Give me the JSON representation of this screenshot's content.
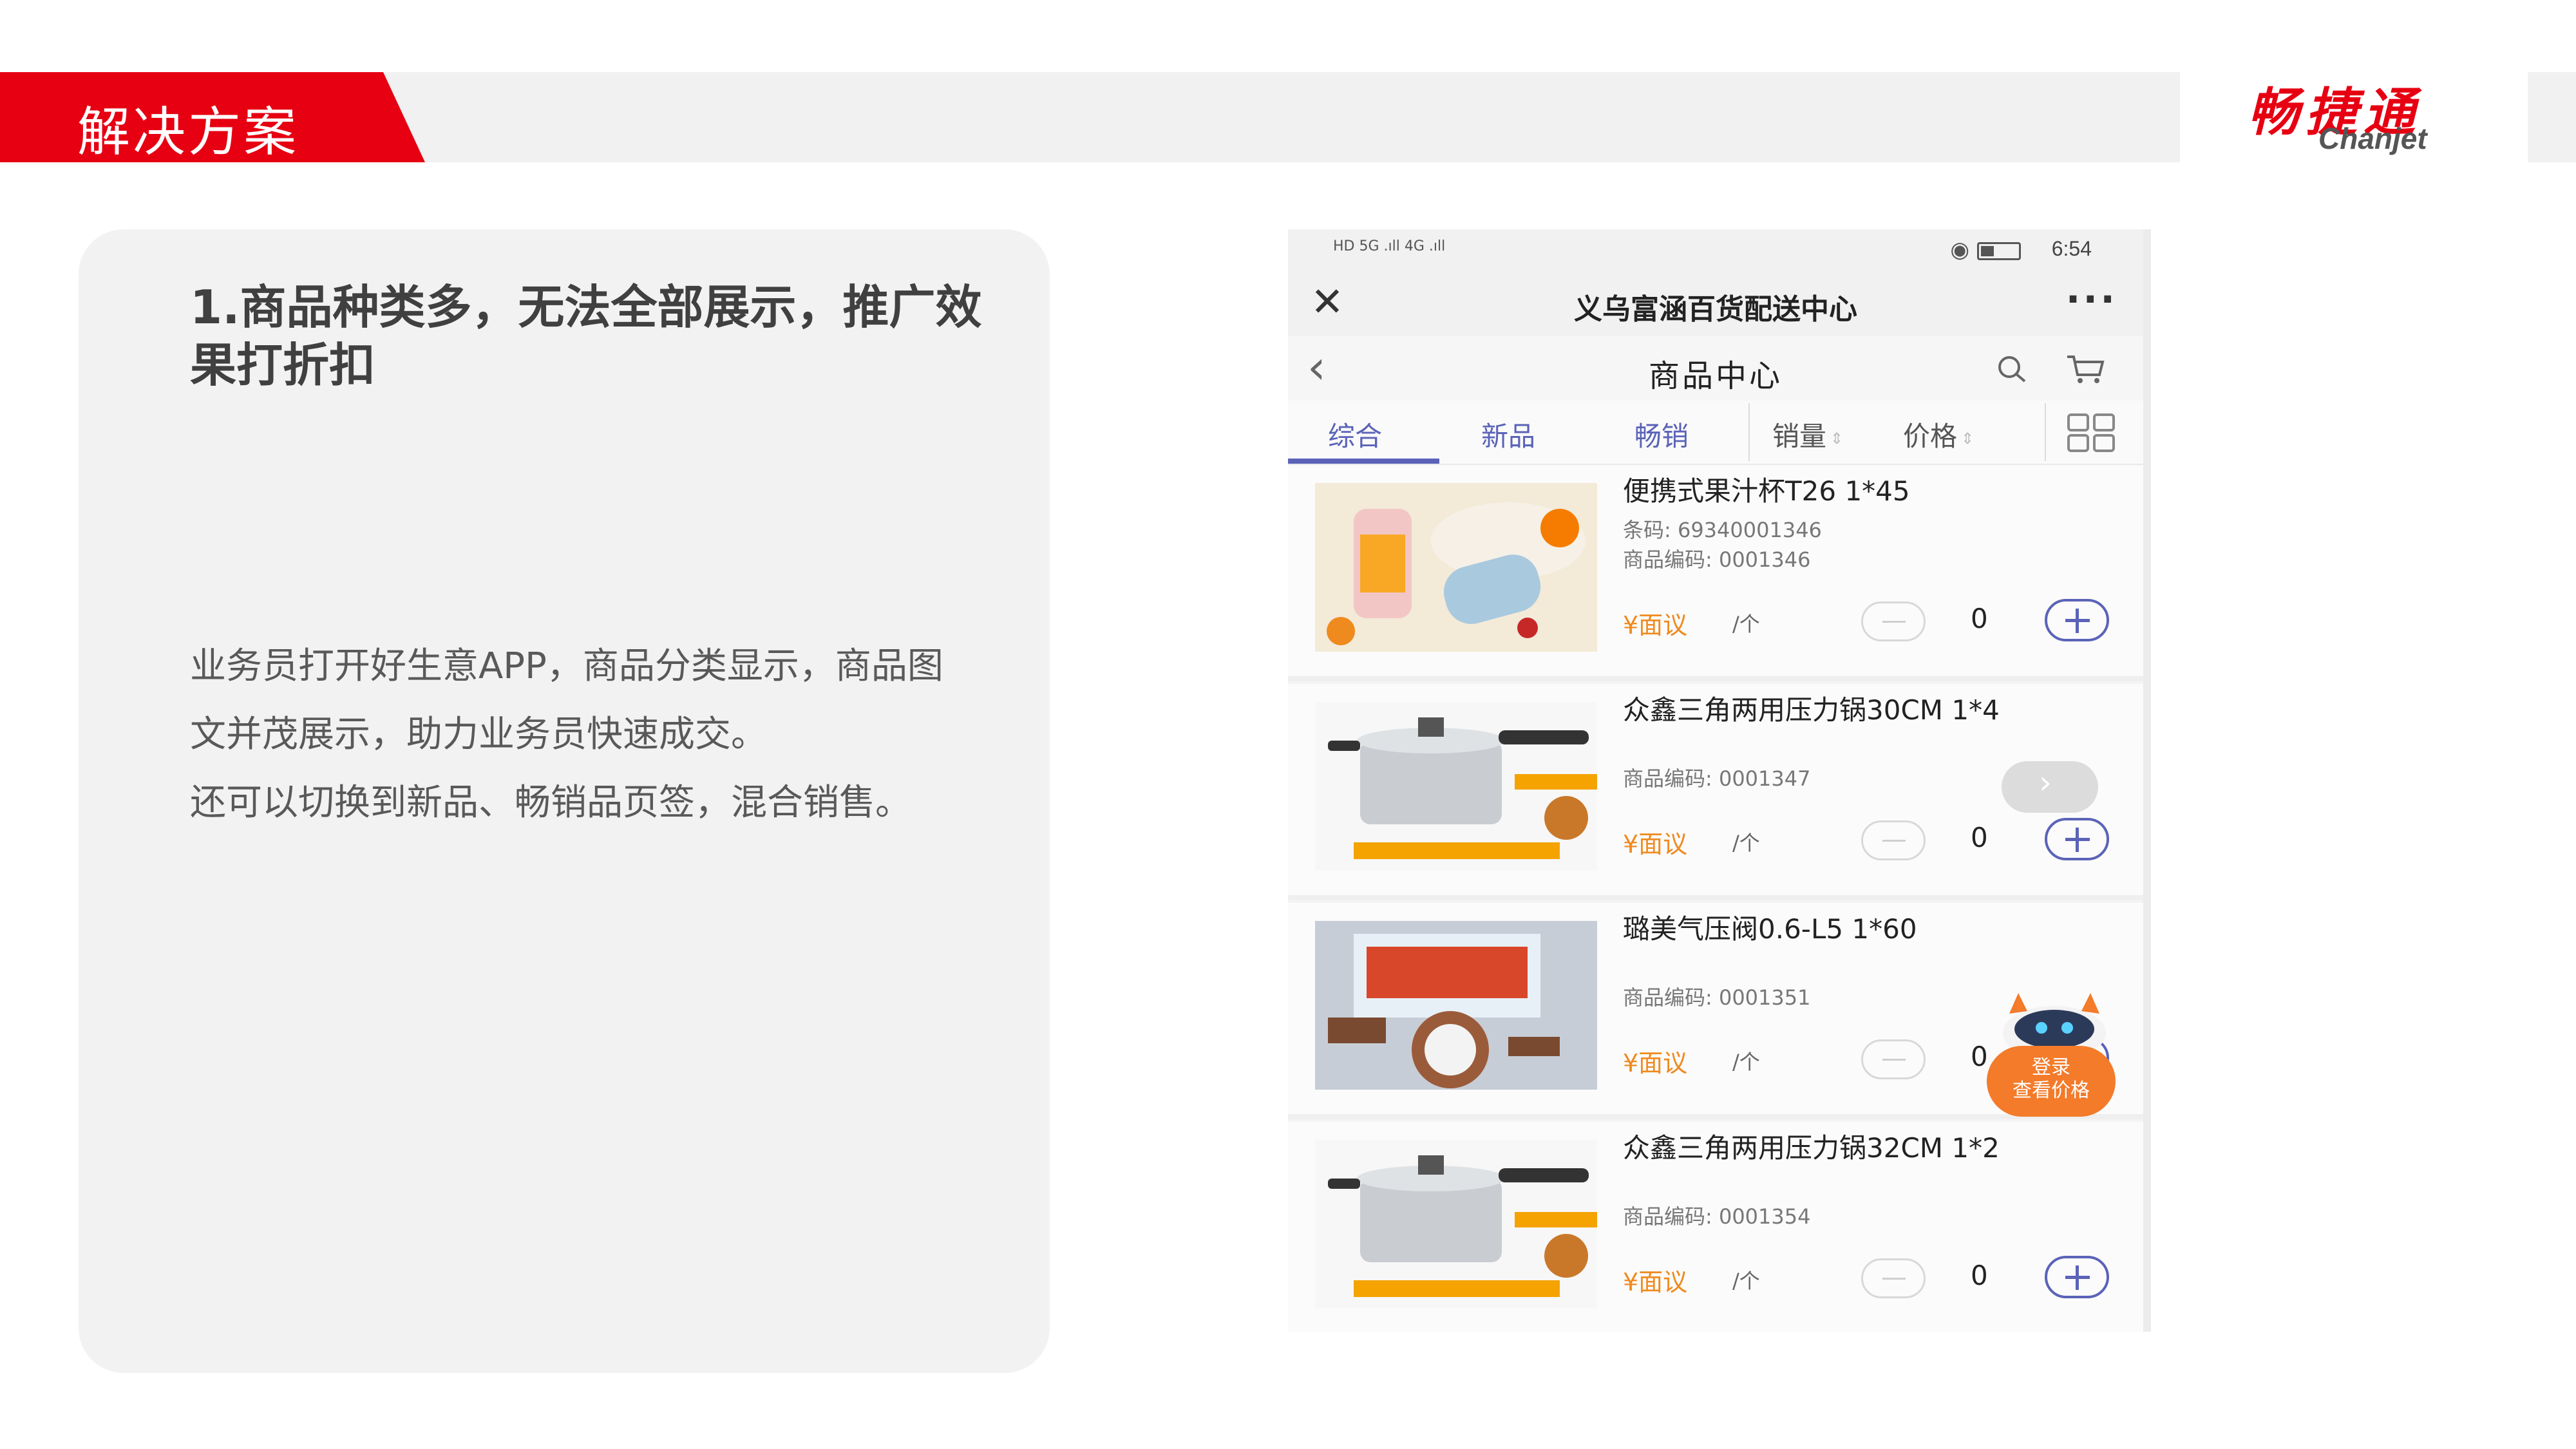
{
  "slide": {
    "section_title": "解决方案",
    "logo_cn": "畅捷通",
    "logo_en": "Chanjet"
  },
  "card": {
    "heading": "1.商品种类多，无法全部展示，推广效果打折扣",
    "body_lines": [
      "业务员打开好生意APP，商品分类显示，商品图",
      "文并茂展示，助力业务员快速成交。",
      "还可以切换到新品、畅销品页签，混合销售。"
    ]
  },
  "phone": {
    "status_time": "6:54",
    "status_left": "HD 5G .ıll 4G .ıll",
    "window_title": "义乌富涵百货配送中心",
    "page_title": "商品中心",
    "tabs": [
      "综合",
      "新品",
      "畅销"
    ],
    "sort_labels": [
      "销量",
      "价格"
    ],
    "products": [
      {
        "name": "便携式果汁杯T26 1*45",
        "barcode": "条码: 69340001346",
        "code": "商品编码: 0001346",
        "price": "¥面议",
        "unit": "/个",
        "qty": "0"
      },
      {
        "name": "众鑫三角两用压力锅30CM 1*4",
        "barcode": "",
        "code": "商品编码: 0001347",
        "price": "¥面议",
        "unit": "/个",
        "qty": "0"
      },
      {
        "name": "璐美气压阀0.6-L5 1*60",
        "barcode": "",
        "code": "商品编码: 0001351",
        "price": "¥面议",
        "unit": "/个",
        "qty": "0"
      },
      {
        "name": "众鑫三角两用压力锅32CM 1*2",
        "barcode": "",
        "code": "商品编码: 0001354",
        "price": "¥面议",
        "unit": "/个",
        "qty": "0"
      }
    ],
    "login_badge": [
      "登录",
      "查看价格"
    ],
    "accent_color": "#5b63b8",
    "price_color": "#f08a1e",
    "brand_red": "#e60012"
  }
}
